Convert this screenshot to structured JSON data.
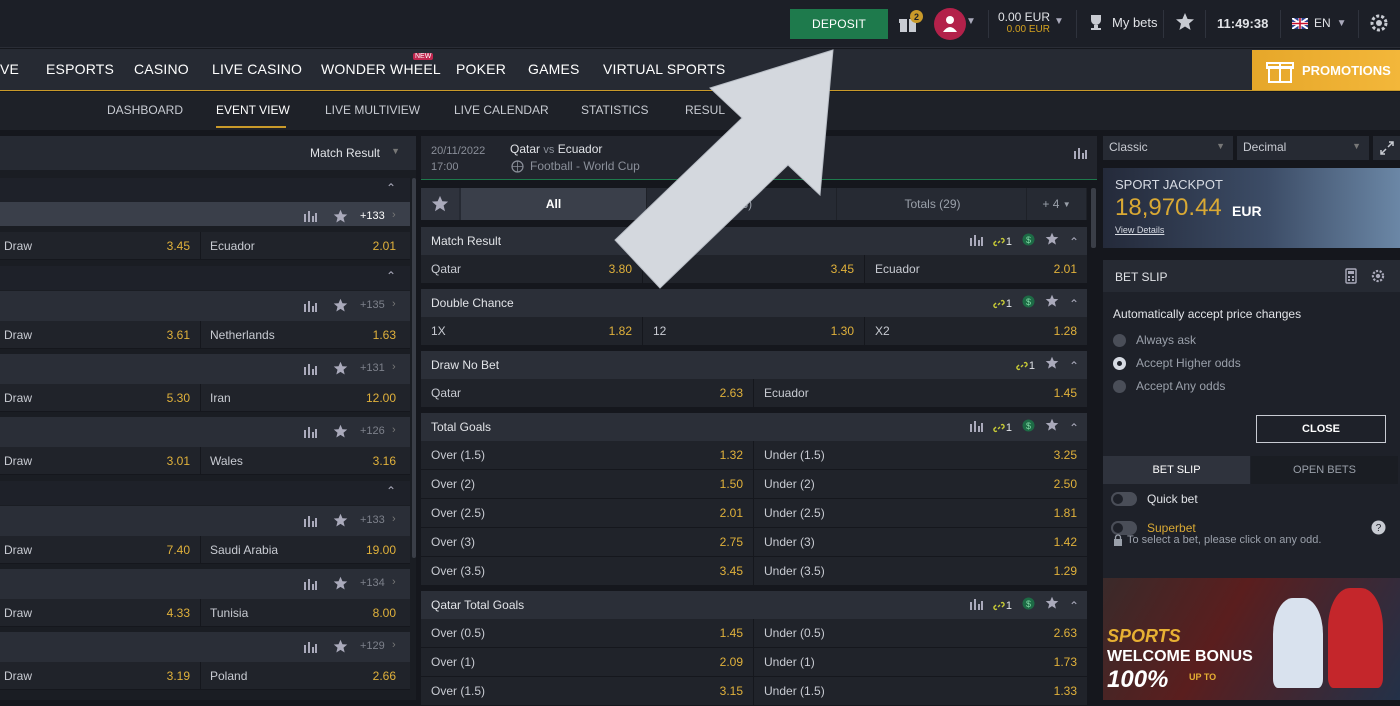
{
  "topbar": {
    "deposit_label": "DEPOSIT",
    "gift_count": "2",
    "balance_main": "0.00 EUR",
    "balance_bonus": "0.00 EUR",
    "mybets_label": "My bets",
    "clock": "11:49:38",
    "language": "EN"
  },
  "mainnav": {
    "items": [
      "VE",
      "ESPORTS",
      "CASINO",
      "LIVE CASINO",
      "WONDER WHEEL",
      "POKER",
      "GAMES",
      "VIRTUAL SPORTS"
    ],
    "new_tag": "NEW",
    "promotions_label": "PROMOTIONS"
  },
  "subnav": {
    "items": [
      "DASHBOARD",
      "EVENT VIEW",
      "LIVE MULTIVIEW",
      "LIVE CALENDAR",
      "STATISTICS",
      "RESUL"
    ],
    "active": "EVENT VIEW"
  },
  "left": {
    "header_market": "Match Result",
    "events": [
      {
        "more": "+133",
        "draw": "Draw",
        "draw_odd": "3.45",
        "team": "Ecuador",
        "team_odd": "2.01"
      },
      {
        "more": "+135",
        "draw": "Draw",
        "draw_odd": "3.61",
        "team": "Netherlands",
        "team_odd": "1.63"
      },
      {
        "more": "+131",
        "draw": "Draw",
        "draw_odd": "5.30",
        "team": "Iran",
        "team_odd": "12.00"
      },
      {
        "more": "+126",
        "draw": "Draw",
        "draw_odd": "3.01",
        "team": "Wales",
        "team_odd": "3.16"
      },
      {
        "more": "+133",
        "draw": "Draw",
        "draw_odd": "7.40",
        "team": "Saudi Arabia",
        "team_odd": "19.00"
      },
      {
        "more": "+134",
        "draw": "Draw",
        "draw_odd": "4.33",
        "team": "Tunisia",
        "team_odd": "8.00"
      },
      {
        "more": "+129",
        "draw": "Draw",
        "draw_odd": "3.19",
        "team": "Poland",
        "team_odd": "2.66"
      }
    ]
  },
  "event": {
    "date": "20/11/2022",
    "time": "17:00",
    "home": "Qatar",
    "vs": "vs",
    "away": "Ecuador",
    "league": "Football - World Cup"
  },
  "tabs": {
    "all": "All",
    "hidden": "(33)",
    "totals": "Totals (29)",
    "more": "+ 4"
  },
  "markets": {
    "match_result": {
      "title": "Match Result",
      "links": "1",
      "o1_l": "Qatar",
      "o1_v": "3.80",
      "o2_l": "D",
      "o2_v": "3.45",
      "o3_l": "Ecuador",
      "o3_v": "2.01"
    },
    "double_chance": {
      "title": "Double Chance",
      "links": "1",
      "o1_l": "1X",
      "o1_v": "1.82",
      "o2_l": "12",
      "o2_v": "1.30",
      "o3_l": "X2",
      "o3_v": "1.28"
    },
    "draw_no_bet": {
      "title": "Draw No Bet",
      "links": "1",
      "o1_l": "Qatar",
      "o1_v": "2.63",
      "o2_l": "Ecuador",
      "o2_v": "1.45"
    },
    "total_goals": {
      "title": "Total Goals",
      "links": "1",
      "rows": [
        {
          "ol": "Over (1.5)",
          "ov": "1.32",
          "ul": "Under (1.5)",
          "uv": "3.25"
        },
        {
          "ol": "Over (2)",
          "ov": "1.50",
          "ul": "Under (2)",
          "uv": "2.50"
        },
        {
          "ol": "Over (2.5)",
          "ov": "2.01",
          "ul": "Under (2.5)",
          "uv": "1.81"
        },
        {
          "ol": "Over (3)",
          "ov": "2.75",
          "ul": "Under (3)",
          "uv": "1.42"
        },
        {
          "ol": "Over (3.5)",
          "ov": "3.45",
          "ul": "Under (3.5)",
          "uv": "1.29"
        }
      ]
    },
    "qatar_total_goals": {
      "title": "Qatar Total Goals",
      "links": "1",
      "rows": [
        {
          "ol": "Over (0.5)",
          "ov": "1.45",
          "ul": "Under (0.5)",
          "uv": "2.63"
        },
        {
          "ol": "Over (1)",
          "ov": "2.09",
          "ul": "Under (1)",
          "uv": "1.73"
        },
        {
          "ol": "Over (1.5)",
          "ov": "3.15",
          "ul": "Under (1.5)",
          "uv": "1.33"
        }
      ]
    }
  },
  "right": {
    "odds_view": "Classic",
    "odds_format": "Decimal",
    "jackpot_title": "SPORT JACKPOT",
    "jackpot_amount": "18,970.44",
    "jackpot_currency": "EUR",
    "jackpot_details": "View Details",
    "betslip_title": "BET SLIP",
    "auto_accept": "Automatically accept price changes",
    "options": [
      "Always ask",
      "Accept Higher odds",
      "Accept Any odds"
    ],
    "close_label": "CLOSE",
    "tab_betslip": "BET SLIP",
    "tab_openbets": "OPEN BETS",
    "quickbet": "Quick bet",
    "superbet": "Superbet",
    "hint": "To select a bet, please click on any odd.",
    "banner_sports": "SPORTS",
    "banner_welcome": "WELCOME BONUS",
    "banner_pct": "100%",
    "banner_upto": "UP TO"
  },
  "colors": {
    "accent": "#c99a2a",
    "odds": "#e0b13b",
    "deposit": "#1e7a4c"
  }
}
